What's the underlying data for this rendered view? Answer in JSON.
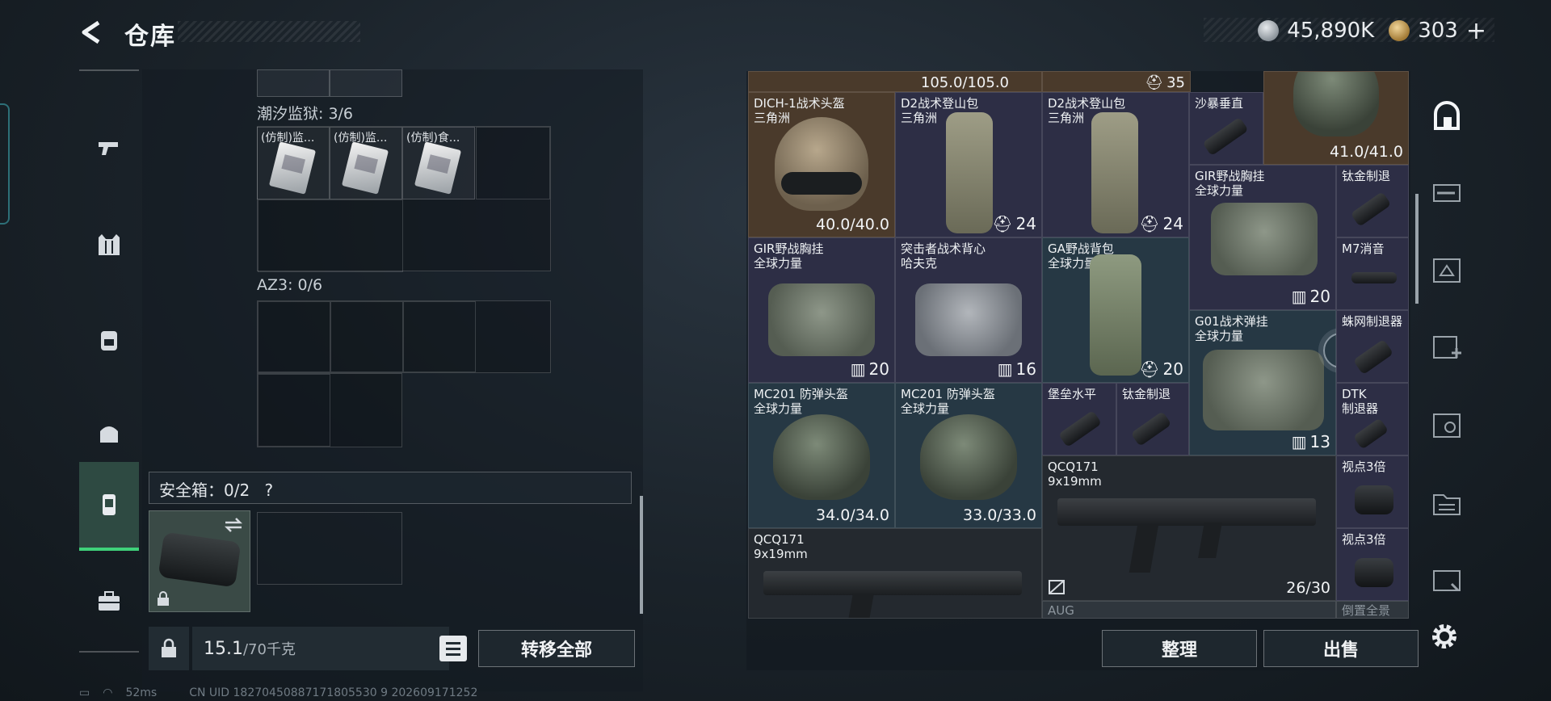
{
  "header": {
    "title": "仓库",
    "currency_silver": "45,890K",
    "currency_gold": "303",
    "plus": "+"
  },
  "left_nav": {
    "items": [
      "gun-icon",
      "vest-icon",
      "backpack-icon",
      "pouch-icon",
      "safe-box-icon",
      "case-icon"
    ],
    "active_index": 4
  },
  "containers": [
    {
      "label": "潮汐监狱: 3/6",
      "items": [
        "(仿制)监...",
        "(仿制)监...",
        "(仿制)食..."
      ]
    },
    {
      "label": "AZ3: 0/6"
    }
  ],
  "safe_box": {
    "label": "安全箱：0/2",
    "help": "?"
  },
  "footer_left": {
    "weight_value": "15.1",
    "weight_unit": "/70千克",
    "transfer_all": "转移全部"
  },
  "status_bar": {
    "ping": "52ms",
    "uid": "CN UID 18270450887171805530 9 202609171252"
  },
  "inventory": {
    "top_row": {
      "value": "105.0/105.0",
      "count": "35"
    },
    "cells": [
      {
        "id": "helmet-dich",
        "name": "DICH-1战术头盔",
        "sub": "三角洲",
        "value": "40.0/40.0"
      },
      {
        "id": "bag-d2-a",
        "name": "D2战术登山包",
        "sub": "三角洲",
        "count": "24"
      },
      {
        "id": "bag-d2-b",
        "name": "D2战术登山包",
        "sub": "三角洲",
        "count": "24"
      },
      {
        "id": "suppressor-shabao",
        "name": "沙暴垂直",
        "sub": ""
      },
      {
        "id": "helmet-top-right",
        "name": "",
        "sub": "",
        "value": "41.0/41.0"
      },
      {
        "id": "vest-gir-a",
        "name": "GIR野战胸挂",
        "sub": "全球力量",
        "count": "20"
      },
      {
        "id": "brake-titanium-a",
        "name": "钛金制退",
        "sub": ""
      },
      {
        "id": "m7-suppressor",
        "name": "M7消音",
        "sub": ""
      },
      {
        "id": "vest-gir-b",
        "name": "GIR野战胸挂",
        "sub": "全球力量",
        "count": "20"
      },
      {
        "id": "vest-assault",
        "name": "突击者战术背心",
        "sub": "哈夫克",
        "count": "16"
      },
      {
        "id": "bag-ga",
        "name": "GA野战背包",
        "sub": "全球力量",
        "count": "20"
      },
      {
        "id": "vest-g01",
        "name": "G01战术弹挂",
        "sub": "全球力量",
        "count": "13"
      },
      {
        "id": "brake-spider",
        "name": "蛛网制退器",
        "sub": ""
      },
      {
        "id": "helmet-mc201-a",
        "name": "MC201 防弹头盔",
        "sub": "全球力量",
        "value": "34.0/34.0"
      },
      {
        "id": "helmet-mc201-b",
        "name": "MC201 防弹头盔",
        "sub": "全球力量",
        "value": "33.0/33.0"
      },
      {
        "id": "fortress-level",
        "name": "堡垒水平",
        "sub": ""
      },
      {
        "id": "brake-titanium-b",
        "name": "钛金制退",
        "sub": ""
      },
      {
        "id": "brake-dtk",
        "name": "DTK",
        "sub": "制退器"
      },
      {
        "id": "gun-qcq-a",
        "name": "QCQ171",
        "sub": "9x19mm",
        "ammo": "26/30"
      },
      {
        "id": "scope-3x-a",
        "name": "视点3倍",
        "sub": ""
      },
      {
        "id": "scope-3x-b",
        "name": "视点3倍",
        "sub": ""
      },
      {
        "id": "gun-qcq-b",
        "name": "QCQ171",
        "sub": "9x19mm"
      },
      {
        "id": "gun-aug",
        "name": "AUG",
        "sub": ""
      },
      {
        "id": "scope-holo",
        "name": "倒置全景",
        "sub": ""
      }
    ]
  },
  "footer_right": {
    "sort": "整理",
    "sell": "出售"
  },
  "colors": {
    "accent_green": "#3fd17a",
    "panel": "#1e272e"
  }
}
